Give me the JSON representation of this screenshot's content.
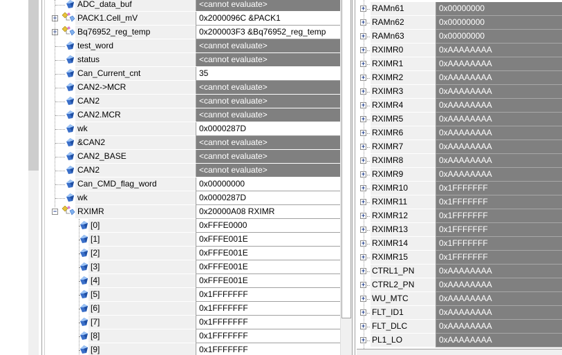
{
  "watch_left": [
    {
      "name": "ADC_data_buf",
      "value": "<cannot evaluate>",
      "type": "var",
      "state": "dark"
    },
    {
      "name": "PACK1.Cell_mV",
      "value": "0x2000096C &PACK1",
      "type": "struct",
      "state": "light",
      "expander": "+"
    },
    {
      "name": "Bq76952_reg_temp",
      "value": "0x200003F3 &Bq76952_reg_temp",
      "type": "struct",
      "state": "light",
      "expander": "+"
    },
    {
      "name": "test_word",
      "value": "<cannot evaluate>",
      "type": "var",
      "state": "dark"
    },
    {
      "name": "status",
      "value": "<cannot evaluate>",
      "type": "var",
      "state": "dark"
    },
    {
      "name": "Can_Current_cnt",
      "value": "35",
      "type": "var",
      "state": "light"
    },
    {
      "name": "CAN2->MCR",
      "value": "<cannot evaluate>",
      "type": "var",
      "state": "dark"
    },
    {
      "name": "CAN2",
      "value": "<cannot evaluate>",
      "type": "var",
      "state": "dark"
    },
    {
      "name": "CAN2.MCR",
      "value": "<cannot evaluate>",
      "type": "var",
      "state": "dark"
    },
    {
      "name": "wk",
      "value": "0x0000287D",
      "type": "var",
      "state": "light"
    },
    {
      "name": "&CAN2",
      "value": "<cannot evaluate>",
      "type": "var",
      "state": "dark"
    },
    {
      "name": "CAN2_BASE",
      "value": "<cannot evaluate>",
      "type": "var",
      "state": "dark"
    },
    {
      "name": "CAN2",
      "value": "<cannot evaluate>",
      "type": "var",
      "state": "dark"
    },
    {
      "name": "Can_CMD_flag_word",
      "value": "0x00000000",
      "type": "var",
      "state": "light"
    },
    {
      "name": "wk",
      "value": "0x0000287D",
      "type": "var",
      "state": "light"
    },
    {
      "name": "RXIMR",
      "value": "0x20000A08 RXIMR",
      "type": "struct",
      "state": "light",
      "expander": "-"
    },
    {
      "name": "[0]",
      "value": "0xFFFE0000",
      "type": "child",
      "state": "light"
    },
    {
      "name": "[1]",
      "value": "0xFFFE001E",
      "type": "child",
      "state": "light"
    },
    {
      "name": "[2]",
      "value": "0xFFFE001E",
      "type": "child",
      "state": "light"
    },
    {
      "name": "[3]",
      "value": "0xFFFE001E",
      "type": "child",
      "state": "light"
    },
    {
      "name": "[4]",
      "value": "0xFFFE001E",
      "type": "child",
      "state": "light"
    },
    {
      "name": "[5]",
      "value": "0x1FFFFFFF",
      "type": "child",
      "state": "light"
    },
    {
      "name": "[6]",
      "value": "0x1FFFFFFF",
      "type": "child",
      "state": "light"
    },
    {
      "name": "[7]",
      "value": "0x1FFFFFFF",
      "type": "child",
      "state": "light"
    },
    {
      "name": "[8]",
      "value": "0x1FFFFFFF",
      "type": "child",
      "state": "light"
    },
    {
      "name": "[9]",
      "value": "0x1FFFFFFF",
      "type": "child",
      "state": "light"
    }
  ],
  "registers_right": [
    {
      "name": "RAMn61",
      "value": "0x00000000"
    },
    {
      "name": "RAMn62",
      "value": "0x00000000"
    },
    {
      "name": "RAMn63",
      "value": "0x00000000"
    },
    {
      "name": "RXIMR0",
      "value": "0xAAAAAAAA"
    },
    {
      "name": "RXIMR1",
      "value": "0xAAAAAAAA"
    },
    {
      "name": "RXIMR2",
      "value": "0xAAAAAAAA"
    },
    {
      "name": "RXIMR3",
      "value": "0xAAAAAAAA"
    },
    {
      "name": "RXIMR4",
      "value": "0xAAAAAAAA"
    },
    {
      "name": "RXIMR5",
      "value": "0xAAAAAAAA"
    },
    {
      "name": "RXIMR6",
      "value": "0xAAAAAAAA"
    },
    {
      "name": "RXIMR7",
      "value": "0xAAAAAAAA"
    },
    {
      "name": "RXIMR8",
      "value": "0xAAAAAAAA"
    },
    {
      "name": "RXIMR9",
      "value": "0xAAAAAAAA"
    },
    {
      "name": "RXIMR10",
      "value": "0x1FFFFFFF"
    },
    {
      "name": "RXIMR11",
      "value": "0x1FFFFFFF"
    },
    {
      "name": "RXIMR12",
      "value": "0x1FFFFFFF"
    },
    {
      "name": "RXIMR13",
      "value": "0x1FFFFFFF"
    },
    {
      "name": "RXIMR14",
      "value": "0x1FFFFFFF"
    },
    {
      "name": "RXIMR15",
      "value": "0x1FFFFFFF"
    },
    {
      "name": "CTRL1_PN",
      "value": "0xAAAAAAAA"
    },
    {
      "name": "CTRL2_PN",
      "value": "0xAAAAAAAA"
    },
    {
      "name": "WU_MTC",
      "value": "0xAAAAAAAA"
    },
    {
      "name": "FLT_ID1",
      "value": "0xAAAAAAAA"
    },
    {
      "name": "FLT_DLC",
      "value": "0xAAAAAAAA"
    },
    {
      "name": "PL1_LO",
      "value": "0xAAAAAAAA"
    }
  ]
}
